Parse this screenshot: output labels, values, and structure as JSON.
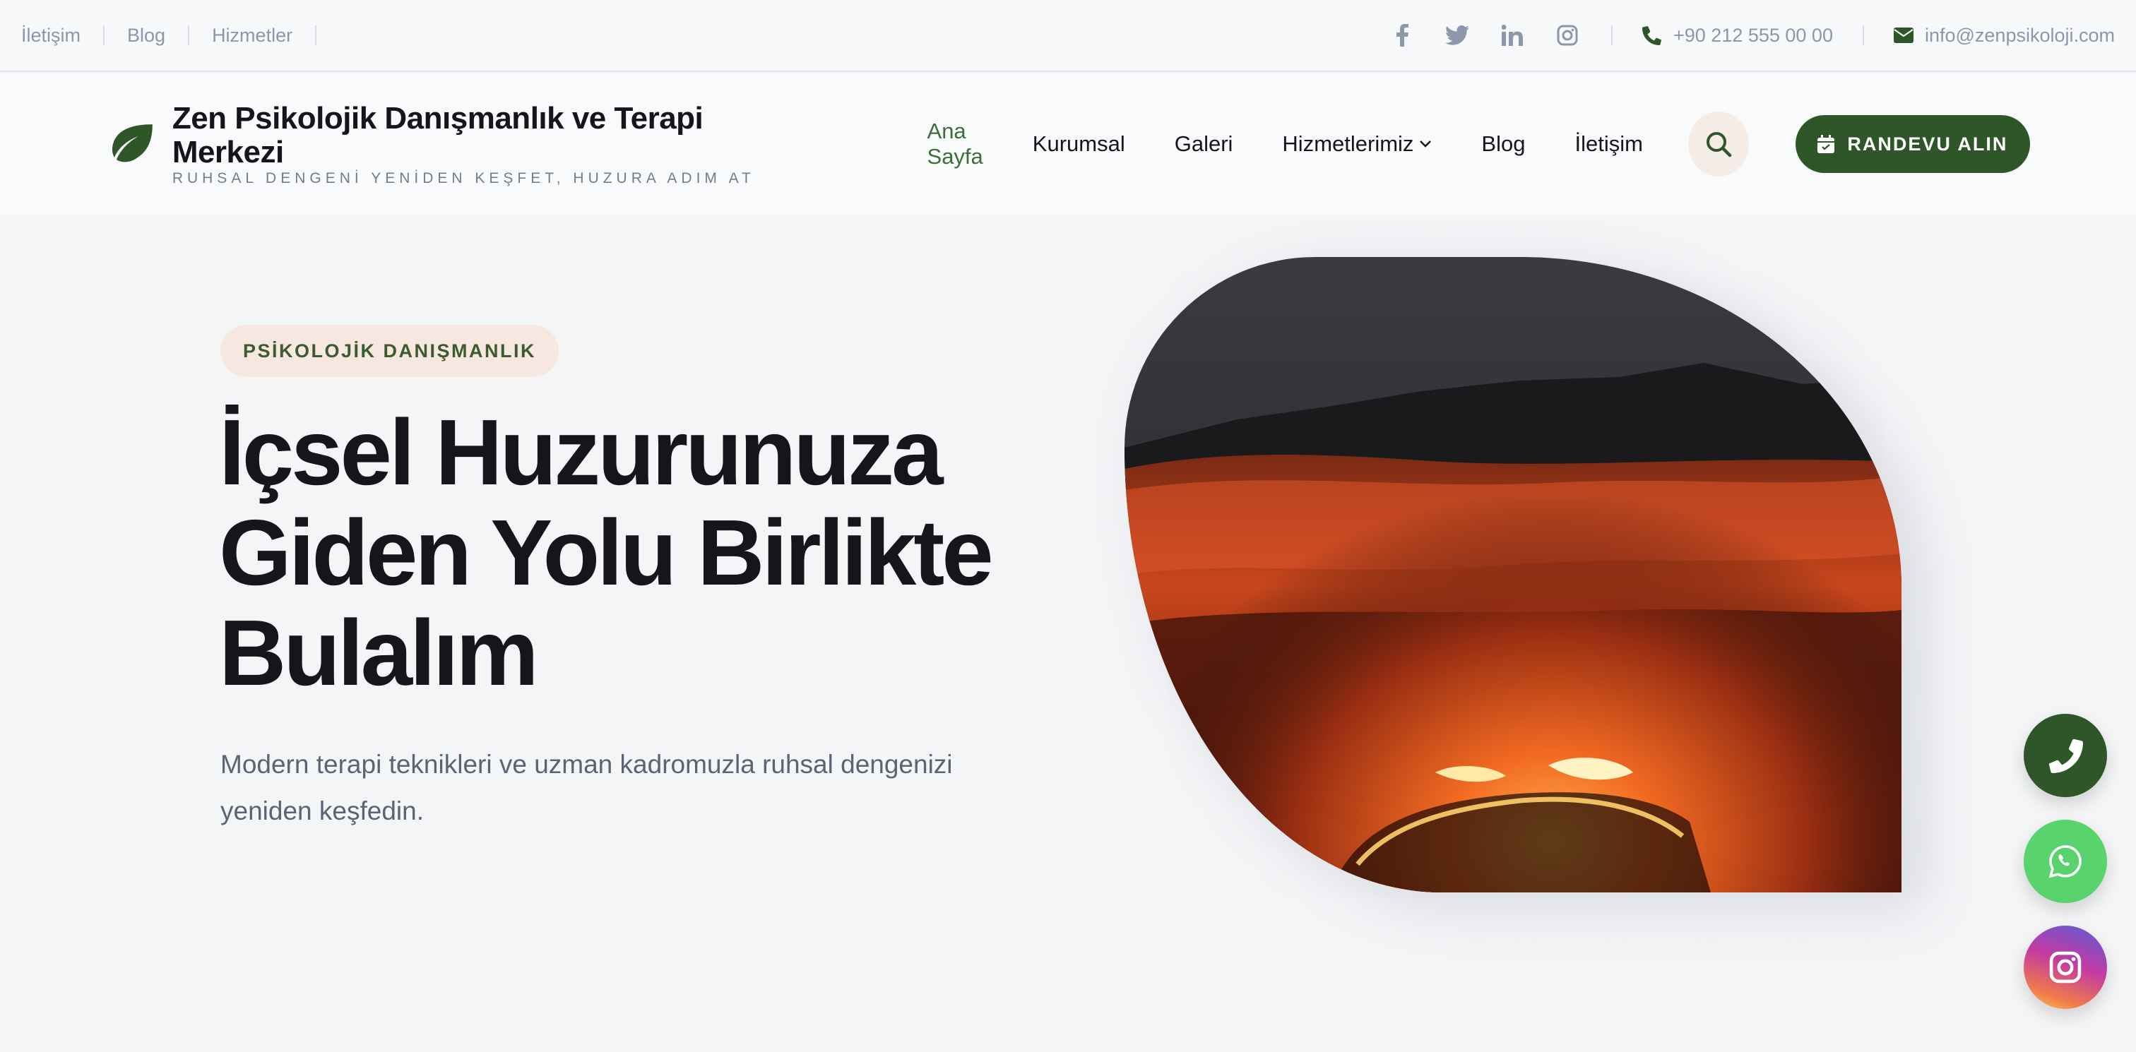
{
  "topbar": {
    "links": [
      "İletişim",
      "Blog",
      "Hizmetler"
    ],
    "socials": [
      "facebook-icon",
      "twitter-icon",
      "linkedin-icon",
      "instagram-icon"
    ],
    "phone": "+90 212 555 00 00",
    "email": "info@zenpsikoloji.com"
  },
  "header": {
    "brand_name": "Zen Psikolojik Danışmanlık ve Terapi Merkezi",
    "brand_tagline": "RUHSAL DENGENİ YENİDEN KEŞFET, HUZURA ADIM AT",
    "nav": {
      "home": "Ana Sayfa",
      "about": "Kurumsal",
      "gallery": "Galeri",
      "services": "Hizmetlerimiz",
      "blog": "Blog",
      "contact": "İletişim"
    },
    "cta_label": "RANDEVU ALIN"
  },
  "hero": {
    "badge": "PSİKOLOJİK DANIŞMANLIK",
    "title_line1": "İçsel Huzurunuza",
    "title_line2": "Giden Yolu Birlikte",
    "title_line3": "Bulalım",
    "subtitle": "Modern terapi teknikleri ve uzman kadromuzla ruhsal dengenizi yeniden keşfedin."
  },
  "floating": [
    "phone-icon",
    "whatsapp-icon",
    "instagram-icon"
  ],
  "colors": {
    "brand_green": "#2f5628",
    "active_nav": "#3a6f3a",
    "badge_bg": "#f7e7e1",
    "whatsapp": "#59d46d"
  }
}
